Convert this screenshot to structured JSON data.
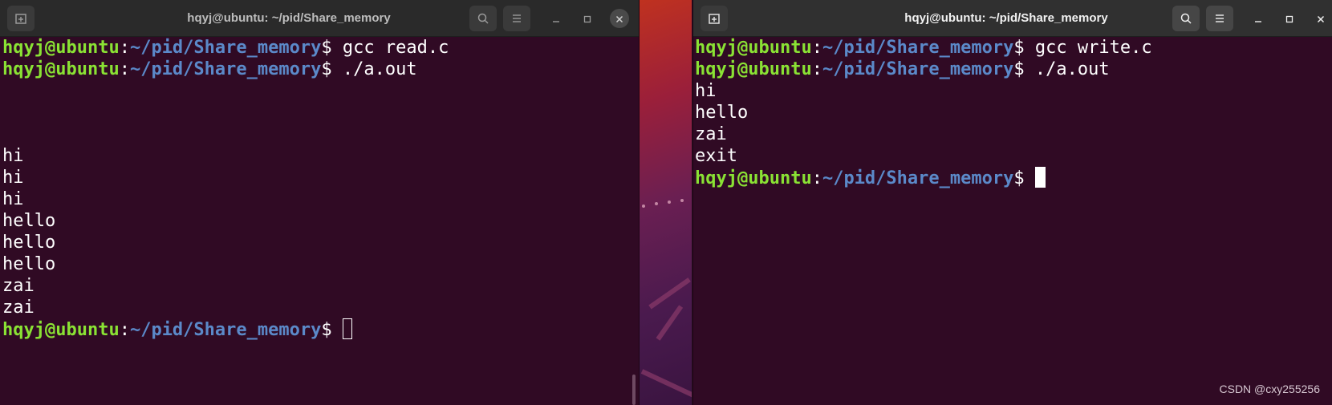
{
  "left_window": {
    "title": "hqyj@ubuntu: ~/pid/Share_memory",
    "lines": [
      {
        "type": "prompt",
        "user": "hqyj@ubuntu",
        "sep": ":",
        "path": "~/pid/Share_memory",
        "dollar": "$ ",
        "cmd": "gcc read.c"
      },
      {
        "type": "prompt",
        "user": "hqyj@ubuntu",
        "sep": ":",
        "path": "~/pid/Share_memory",
        "dollar": "$ ",
        "cmd": "./a.out"
      },
      {
        "type": "text",
        "text": ""
      },
      {
        "type": "text",
        "text": ""
      },
      {
        "type": "text",
        "text": ""
      },
      {
        "type": "text",
        "text": "hi"
      },
      {
        "type": "text",
        "text": "hi"
      },
      {
        "type": "text",
        "text": "hi"
      },
      {
        "type": "text",
        "text": "hello"
      },
      {
        "type": "text",
        "text": "hello"
      },
      {
        "type": "text",
        "text": "hello"
      },
      {
        "type": "text",
        "text": "zai"
      },
      {
        "type": "text",
        "text": "zai"
      },
      {
        "type": "prompt",
        "user": "hqyj@ubuntu",
        "sep": ":",
        "path": "~/pid/Share_memory",
        "dollar": "$ ",
        "cmd": "",
        "cursor": "hollow"
      }
    ]
  },
  "right_window": {
    "title": "hqyj@ubuntu: ~/pid/Share_memory",
    "lines": [
      {
        "type": "prompt",
        "user": "hqyj@ubuntu",
        "sep": ":",
        "path": "~/pid/Share_memory",
        "dollar": "$ ",
        "cmd": "gcc write.c"
      },
      {
        "type": "prompt",
        "user": "hqyj@ubuntu",
        "sep": ":",
        "path": "~/pid/Share_memory",
        "dollar": "$ ",
        "cmd": "./a.out"
      },
      {
        "type": "text",
        "text": "hi"
      },
      {
        "type": "text",
        "text": "hello"
      },
      {
        "type": "text",
        "text": "zai"
      },
      {
        "type": "text",
        "text": "exit"
      },
      {
        "type": "prompt",
        "user": "hqyj@ubuntu",
        "sep": ":",
        "path": "~/pid/Share_memory",
        "dollar": "$ ",
        "cmd": "",
        "cursor": "solid"
      }
    ]
  },
  "icons": {
    "new_tab": "new-tab-icon",
    "search": "search-icon",
    "menu": "hamburger-menu-icon",
    "minimize": "minimize-icon",
    "maximize": "maximize-icon",
    "close": "close-icon"
  },
  "colors": {
    "terminal_bg": "#300a24",
    "user": "#8ae234",
    "path": "#5b89c9",
    "text": "#ffffff"
  },
  "watermark": "CSDN @cxy255256"
}
